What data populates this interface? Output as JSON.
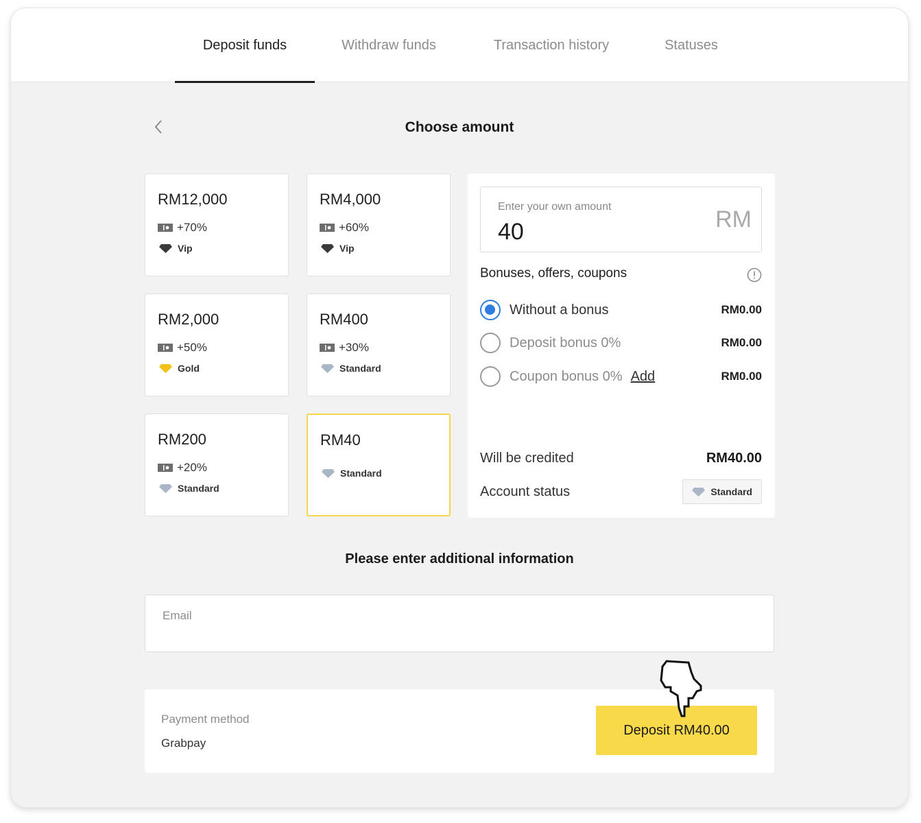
{
  "tabs": [
    {
      "label": "Deposit funds",
      "active": true
    },
    {
      "label": "Withdraw funds",
      "active": false
    },
    {
      "label": "Transaction history",
      "active": false
    },
    {
      "label": "Statuses",
      "active": false
    }
  ],
  "page_title": "Choose amount",
  "amount_cards": [
    {
      "amount": "RM12,000",
      "bonus": "+70%",
      "status": "Vip",
      "status_color": "#3a3a3a"
    },
    {
      "amount": "RM4,000",
      "bonus": "+60%",
      "status": "Vip",
      "status_color": "#3a3a3a"
    },
    {
      "amount": "RM2,000",
      "bonus": "+50%",
      "status": "Gold",
      "status_color": "#f2c21b"
    },
    {
      "amount": "RM400",
      "bonus": "+30%",
      "status": "Standard",
      "status_color": "#a9b6c6"
    },
    {
      "amount": "RM200",
      "bonus": "+20%",
      "status": "Standard",
      "status_color": "#a9b6c6"
    },
    {
      "amount": "RM40",
      "bonus": "",
      "status": "Standard",
      "status_color": "#a9b6c6",
      "selected": true
    }
  ],
  "custom_amount": {
    "label": "Enter your own amount",
    "value": "40",
    "currency": "RM"
  },
  "bonuses": {
    "title": "Bonuses, offers, coupons",
    "options": [
      {
        "label": "Without a bonus",
        "value": "RM0.00",
        "selected": true
      },
      {
        "label": "Deposit bonus 0%",
        "value": "RM0.00",
        "selected": false
      },
      {
        "label": "Coupon bonus 0%",
        "value": "RM0.00",
        "selected": false,
        "link": "Add"
      }
    ]
  },
  "credited": {
    "label": "Will be credited",
    "value": "RM40.00"
  },
  "account_status": {
    "label": "Account status",
    "value": "Standard"
  },
  "additional_info_title": "Please enter additional information",
  "email": {
    "placeholder": "Email",
    "value": ""
  },
  "payment": {
    "label": "Payment method",
    "value": "Grabpay"
  },
  "deposit_button": "Deposit RM40.00",
  "colors": {
    "accent": "#f8d949",
    "selected_border": "#f3d54e",
    "radio": "#2f7de1"
  }
}
